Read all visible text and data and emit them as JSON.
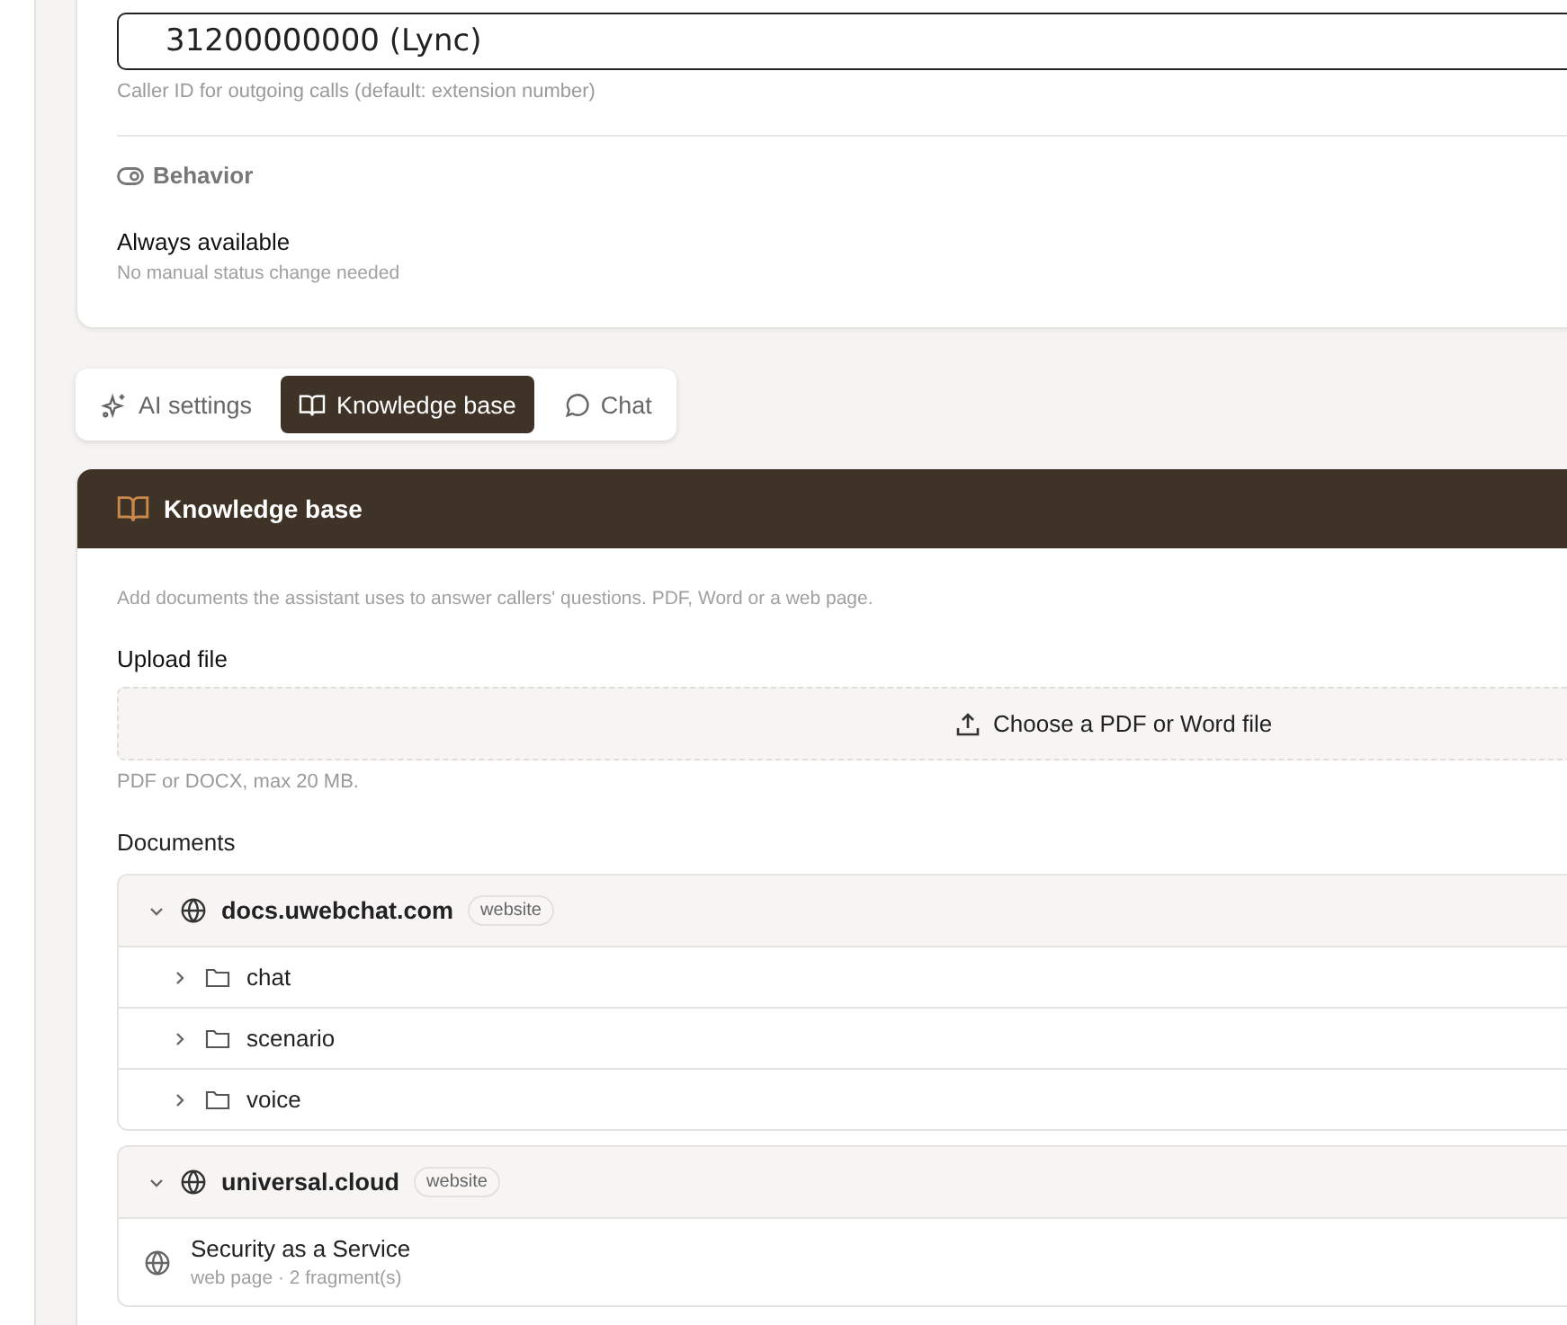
{
  "outbound": {
    "value": "31200000000 (Lync)",
    "hint": "Caller ID for outgoing calls (default: extension number)"
  },
  "behavior": {
    "title": "Behavior",
    "label": "Always available",
    "description": "No manual status change needed"
  },
  "tabs": [
    {
      "label": "AI settings",
      "kind": "sparkles",
      "selected": false
    },
    {
      "label": "Knowledge base",
      "kind": "book",
      "selected": true
    },
    {
      "label": "Chat",
      "kind": "chat",
      "selected": false
    }
  ],
  "panel": {
    "title": "Knowledge base",
    "intro": "Add documents the assistant uses to answer callers' questions. PDF, Word or a web page.",
    "upload_label": "Upload file",
    "upload_button": "Choose a PDF or Word file",
    "upload_hint": "PDF or DOCX, max 20 MB.",
    "documents_label": "Documents"
  },
  "documents": [
    {
      "name": "docs.uwebchat.com",
      "badge": "website",
      "expanded": true,
      "children": [
        {
          "kind": "folder",
          "name": "chat",
          "expanded": false
        },
        {
          "kind": "folder",
          "name": "scenario",
          "expanded": false
        },
        {
          "kind": "folder",
          "name": "voice",
          "expanded": false
        }
      ]
    },
    {
      "name": "universal.cloud",
      "badge": "website",
      "expanded": true,
      "children": [
        {
          "kind": "page",
          "name": "Security as a Service",
          "meta": "web page · 2 fragment(s)"
        }
      ]
    }
  ]
}
